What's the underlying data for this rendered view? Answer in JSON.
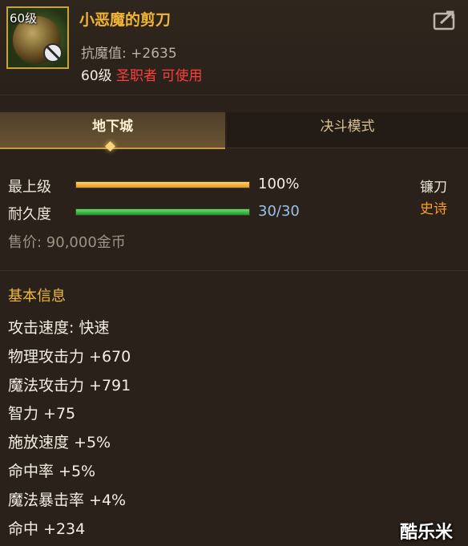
{
  "item": {
    "level_badge": "60级",
    "name": "小恶魔的剪刀",
    "resist_label": "抗魔值:",
    "resist_value": "+2635",
    "required_level": "60级",
    "class_requirement": "圣职者 可使用",
    "icon": "scissors-item-icon",
    "status_icon": "ban-icon"
  },
  "share": {
    "icon": "share-icon"
  },
  "tabs": [
    {
      "label": "地下城",
      "active": true
    },
    {
      "label": "决斗模式",
      "active": false
    }
  ],
  "stats": {
    "quality_label": "最上级",
    "quality_value": "100%",
    "quality_fill": 1.0,
    "durability_label": "耐久度",
    "durability_value": "30/30",
    "durability_fill": 1.0,
    "weapon_type": "镰刀",
    "rarity": "史诗",
    "price": "售价: 90,000金币"
  },
  "basic_info": {
    "title": "基本信息",
    "attributes": [
      "攻击速度: 快速",
      "物理攻击力 +670",
      "魔法攻击力 +791",
      "智力 +75",
      "施放速度 +5%",
      "命中率 +5%",
      "魔法暴击率 +4%",
      "命中 +234"
    ]
  },
  "watermark": "酷乐米",
  "colors": {
    "accent_gold": "#f2b436",
    "requirement_red": "#ff3d3d",
    "rarity_orange": "#ff9d1f",
    "durability_blue": "#9bc0e8"
  }
}
